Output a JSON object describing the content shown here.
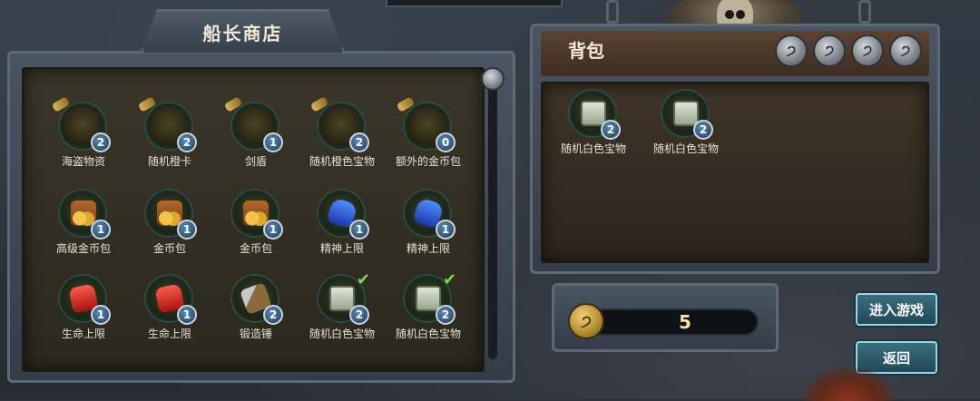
{
  "shop": {
    "title": "船长商店",
    "items": [
      {
        "label": "海盗物资",
        "count": "2",
        "icon": "supply-icon",
        "empty": true
      },
      {
        "label": "随机橙卡",
        "count": "2",
        "icon": "card-icon",
        "empty": true
      },
      {
        "label": "剑盾",
        "count": "1",
        "icon": "sword-shield-icon",
        "empty": true
      },
      {
        "label": "随机橙色宝物",
        "count": "2",
        "icon": "treasure-icon",
        "empty": true
      },
      {
        "label": "额外的金币包",
        "count": "0",
        "icon": "coin-pack-icon",
        "empty": true
      },
      {
        "label": "高级金币包",
        "count": "1",
        "icon": "coin-bag-icon"
      },
      {
        "label": "金币包",
        "count": "1",
        "icon": "coin-bag-icon"
      },
      {
        "label": "金币包",
        "count": "1",
        "icon": "coin-bag-icon"
      },
      {
        "label": "精神上限",
        "count": "1",
        "icon": "blue-potion-icon"
      },
      {
        "label": "精神上限",
        "count": "1",
        "icon": "blue-potion-icon"
      },
      {
        "label": "生命上限",
        "count": "1",
        "icon": "red-potion-icon"
      },
      {
        "label": "生命上限",
        "count": "1",
        "icon": "red-potion-icon"
      },
      {
        "label": "锻造锤",
        "count": "2",
        "icon": "hammer-icon"
      },
      {
        "label": "随机白色宝物",
        "count": "2",
        "icon": "white-chest-icon",
        "checked": true
      },
      {
        "label": "随机白色宝物",
        "count": "2",
        "icon": "white-chest-icon",
        "checked": true
      }
    ]
  },
  "bag": {
    "title": "背包",
    "slot_glyph": "੭",
    "items": [
      {
        "label": "随机白色宝物",
        "count": "2",
        "icon": "white-chest-icon"
      },
      {
        "label": "随机白色宝物",
        "count": "2",
        "icon": "white-chest-icon"
      }
    ]
  },
  "currency": {
    "glyph": "੭",
    "value": "5"
  },
  "buttons": {
    "enter_game": "进入游戏",
    "back": "返回"
  },
  "colors": {
    "panel": "#343d47",
    "inner": "#2b281f",
    "button": "#214957",
    "badge": "#1f3b5b",
    "check": "#7cd64a"
  }
}
